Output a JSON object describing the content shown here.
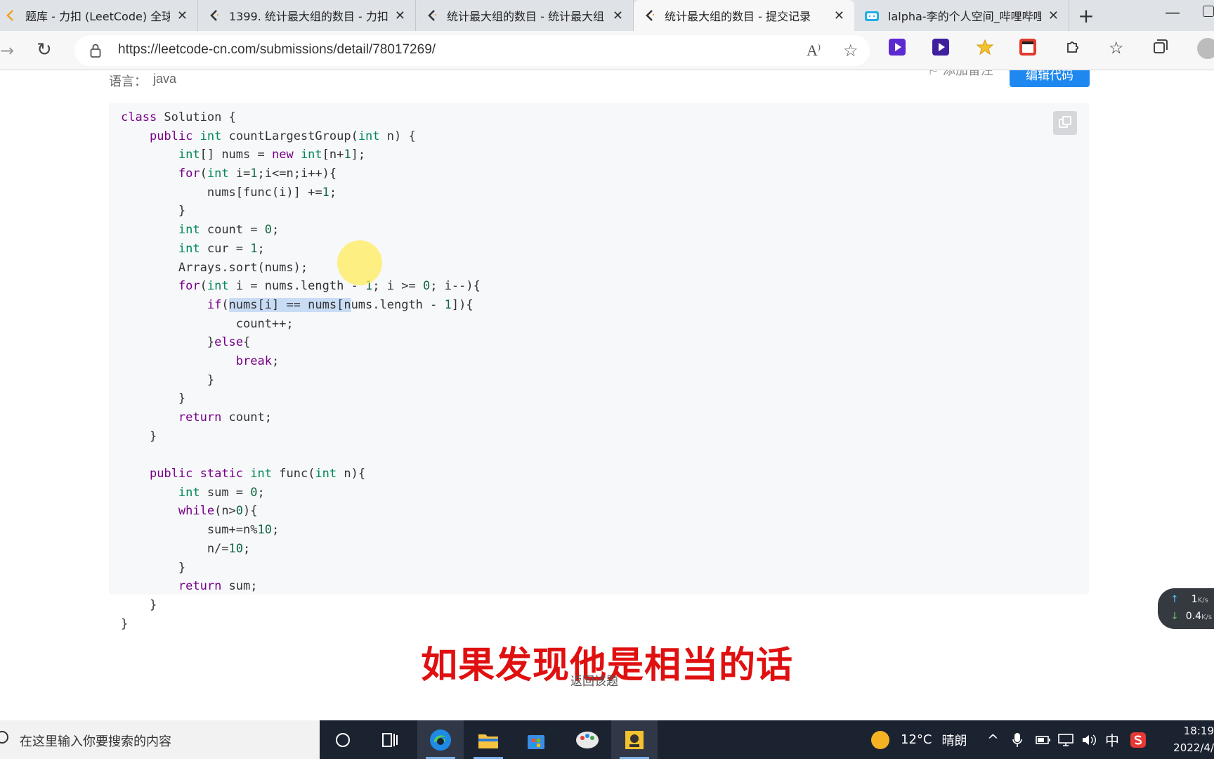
{
  "browser": {
    "tabs": [
      {
        "title": "题库 - 力扣 (LeetCode) 全球极客",
        "icon": "leetcode-icon"
      },
      {
        "title": "1399. 统计最大组的数目 - 力扣",
        "icon": "leetcode-icon"
      },
      {
        "title": "统计最大组的数目 - 统计最大组",
        "icon": "leetcode-icon"
      },
      {
        "title": "统计最大组的数目 - 提交记录",
        "icon": "leetcode-icon",
        "active": true
      },
      {
        "title": "lalpha-李的个人空间_哔哩哔哩",
        "icon": "bilibili-icon"
      }
    ],
    "new_tab_label": "+",
    "url": "https://leetcode-cn.com/submissions/detail/78017269/",
    "read_aloud_glyph": "A",
    "read_aloud_sup": ")"
  },
  "submission": {
    "language_label": "语言：",
    "language": "java",
    "add_note_label": "添加备注",
    "edit_code_label": "编辑代码",
    "back_label": "返回该题"
  },
  "code_lines": [
    "class Solution {",
    "    public int countLargestGroup(int n) {",
    "        int[] nums = new int[n+1];",
    "        for(int i=1;i<=n;i++){",
    "            nums[func(i)] +=1;",
    "        }",
    "        int count = 0;",
    "        int cur = 1;",
    "        Arrays.sort(nums);",
    "        for(int i = nums.length - 1; i >= 0; i--){",
    "            if(nums[i] == nums[nums.length - 1]){",
    "                count++;",
    "            }else{",
    "                break;",
    "            }",
    "        }",
    "        return count;",
    "    }",
    "",
    "    public static int func(int n){",
    "        int sum = 0;",
    "        while(n>0){",
    "            sum+=n%10;",
    "            n/=10;",
    "        }",
    "        return sum;",
    "    }",
    "}"
  ],
  "subtitle": "如果发现他是相当的话",
  "net_speed": {
    "up": "1",
    "up_unit": "K/s",
    "down": "0.4",
    "down_unit": "K/s"
  },
  "taskbar": {
    "search_placeholder": "在这里输入你要搜索的内容",
    "weather_temp": "12°C",
    "weather_text": "晴朗",
    "ime": "中",
    "time": "18:19",
    "date": "2022/4/"
  },
  "colors": {
    "accent": "#1e88f0",
    "subtitle": "#e01010",
    "keyword": "#770088",
    "type": "#008855"
  }
}
